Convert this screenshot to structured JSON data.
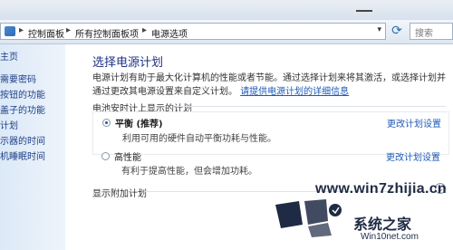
{
  "window": {
    "minimize_label": "—"
  },
  "address_bar": {
    "crumbs": [
      "控制面板",
      "所有控制面板项",
      "电源选项"
    ],
    "separator": "▸",
    "dropdown": "▾",
    "refresh": "⟳",
    "search_placeholder": "搜索"
  },
  "sidebar": {
    "items": [
      "主页",
      "需要密码",
      "按钮的功能",
      "盖子的功能",
      "计划",
      "示器的时间",
      "机睡眠时间"
    ]
  },
  "main": {
    "title": "选择电源计划",
    "intro_text": "电源计划有助于最大化计算机的性能或者节能。通过选择计划来将其激活，或选择计划并通过更改其电源设置来自定义计划。",
    "intro_link": "请提供电源计划的详细信息",
    "group_label": "电池安时计上显示的计划",
    "plans": [
      {
        "name": "平衡 (推荐)",
        "desc": "利用可用的硬件自动平衡功耗与性能。",
        "change": "更改计划设置",
        "selected": true
      },
      {
        "name": "高性能",
        "desc": "有利于提高性能，但会增加功耗。",
        "change": "更改计划设置",
        "selected": false
      }
    ],
    "more_label": "显示附加计划",
    "expand_icon": "⌄"
  },
  "watermark": {
    "domain": "www.win7zhijia.cn",
    "brand_cn": "系统之家",
    "site": "Win10net.com"
  }
}
